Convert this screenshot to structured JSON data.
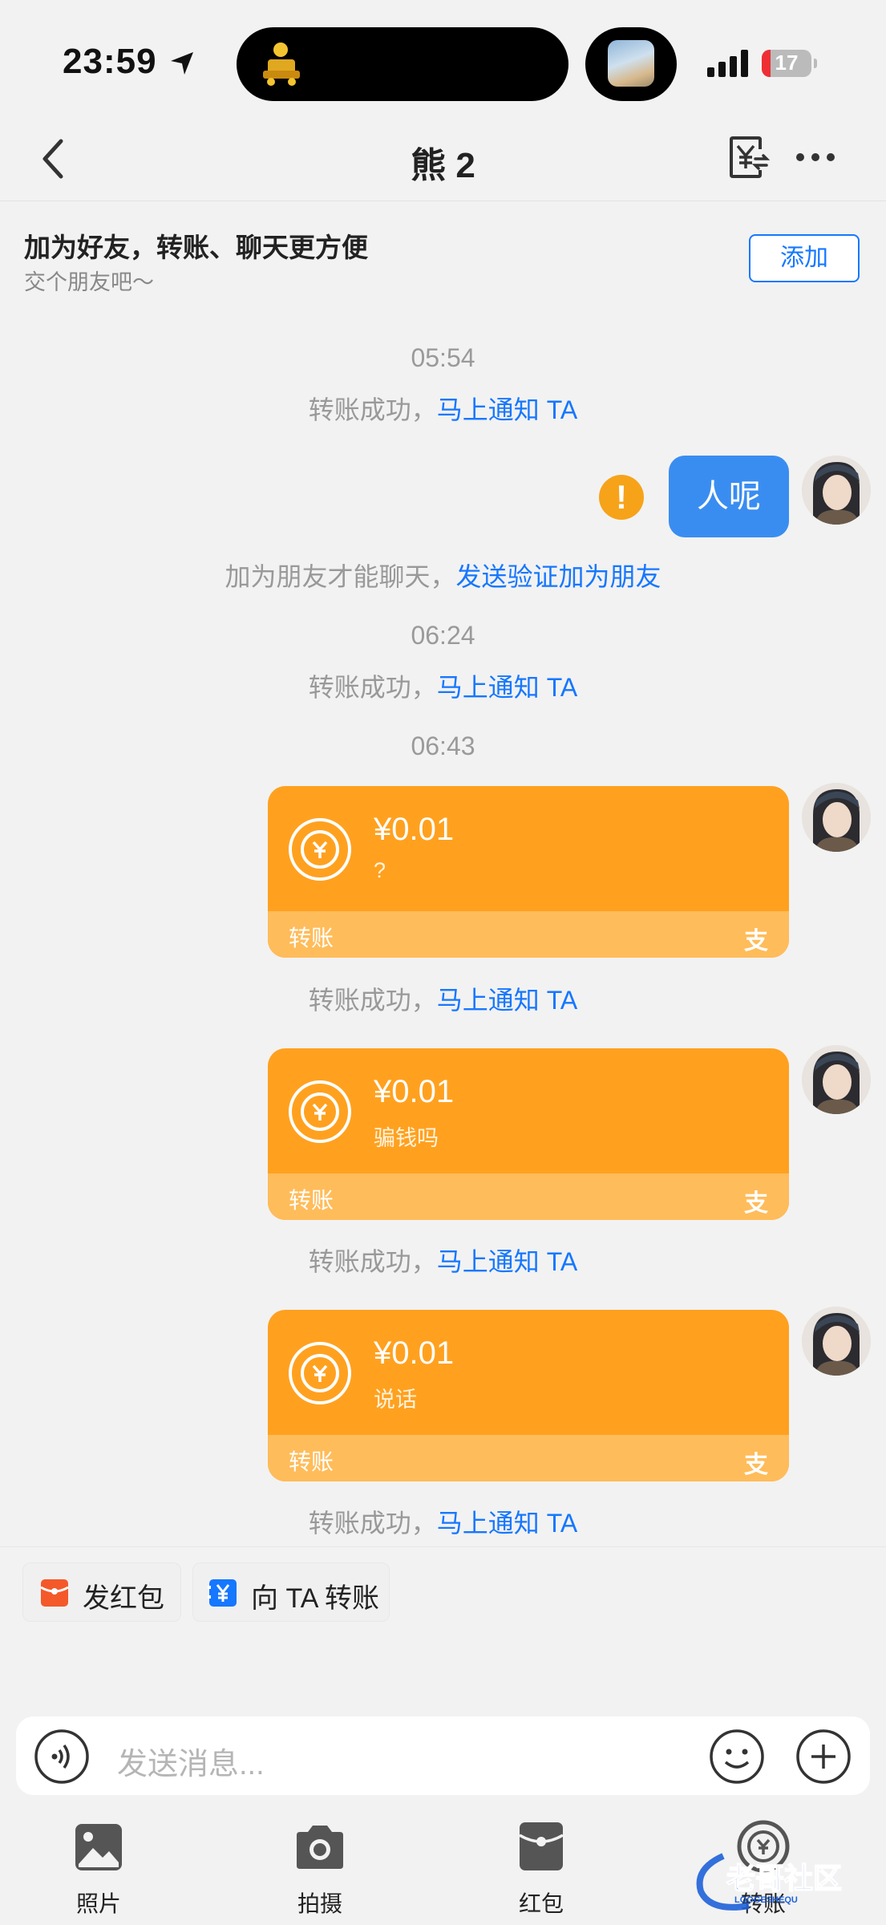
{
  "status_bar": {
    "time": "23:59",
    "battery": "17",
    "battery_level": 0.17
  },
  "nav": {
    "title": "熊 2"
  },
  "add_friend_banner": {
    "title": "加为好友，转账、聊天更方便",
    "subtitle": "交个朋友吧～",
    "button": "添加"
  },
  "chat": {
    "time_1": "05:54",
    "sys_1": {
      "text": "转账成功，",
      "link": "马上通知 TA"
    },
    "message_1": {
      "text": "人呢",
      "status": "!"
    },
    "sys_friend": {
      "text": "加为朋友才能聊天，",
      "link": "发送验证加为朋友"
    },
    "time_2": "06:24",
    "sys_2": {
      "text": "转账成功，",
      "link": "马上通知 TA"
    },
    "time_3": "06:43",
    "transfers": [
      {
        "amount": "¥0.01",
        "note": "?",
        "label": "转账",
        "brand": "支"
      },
      {
        "amount": "¥0.01",
        "note": "骗钱吗",
        "label": "转账",
        "brand": "支"
      },
      {
        "amount": "¥0.01",
        "note": "说话",
        "label": "转账",
        "brand": "支"
      }
    ],
    "sys_3": {
      "text": "转账成功，",
      "link": "马上通知 TA"
    },
    "sys_4": {
      "text": "转账成功，",
      "link": "马上通知 TA"
    },
    "sys_5": {
      "text": "转账成功，",
      "link": "马上通知 TA"
    }
  },
  "quick_actions": {
    "red_packet": "发红包",
    "transfer": "向 TA 转账"
  },
  "input": {
    "placeholder": "发送消息..."
  },
  "toolbar": {
    "photos": "照片",
    "camera": "拍摄",
    "red_packet": "红包",
    "transfer": "转账"
  },
  "watermark": {
    "text": "老哥社区",
    "sub": "LOOGESHEQU"
  },
  "colors": {
    "accent": "#1677ff",
    "card": "#ffa11f",
    "card_footer": "#ffbc5a",
    "bubble": "#3a8df0",
    "warning": "#f6a31a"
  }
}
